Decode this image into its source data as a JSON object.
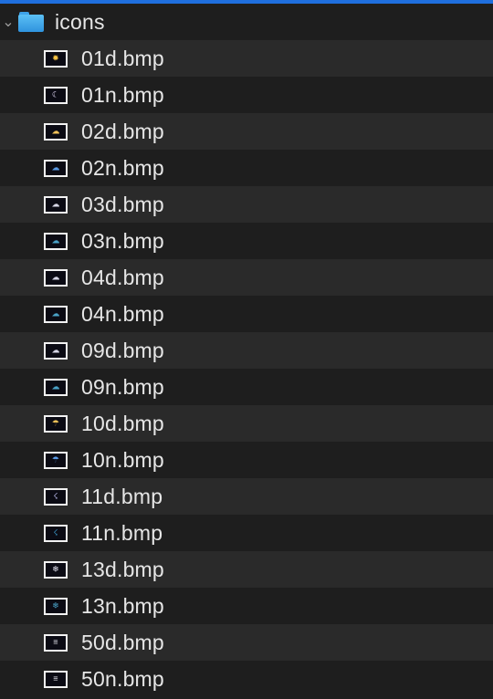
{
  "folder": {
    "name": "icons",
    "icon": "folder-icon",
    "expanded": true
  },
  "files": [
    {
      "name": "01d.bmp",
      "icon": "sun-icon",
      "color": "#f6c343"
    },
    {
      "name": "01n.bmp",
      "icon": "moon-icon",
      "color": "#e9e0ff"
    },
    {
      "name": "02d.bmp",
      "icon": "sun-cloud-icon",
      "color": "#f2c35a"
    },
    {
      "name": "02n.bmp",
      "icon": "moon-cloud-icon",
      "color": "#5a9be6"
    },
    {
      "name": "03d.bmp",
      "icon": "cloud-icon",
      "color": "#d8d8e8"
    },
    {
      "name": "03n.bmp",
      "icon": "cloud-icon",
      "color": "#4aa3c9"
    },
    {
      "name": "04d.bmp",
      "icon": "clouds-icon",
      "color": "#d8d8e8"
    },
    {
      "name": "04n.bmp",
      "icon": "clouds-icon",
      "color": "#4aa3c9"
    },
    {
      "name": "09d.bmp",
      "icon": "rain-cloud-icon",
      "color": "#d8d8e8"
    },
    {
      "name": "09n.bmp",
      "icon": "rain-cloud-icon",
      "color": "#4aa3c9"
    },
    {
      "name": "10d.bmp",
      "icon": "sun-rain-icon",
      "color": "#f2c35a"
    },
    {
      "name": "10n.bmp",
      "icon": "moon-rain-icon",
      "color": "#5a9be6"
    },
    {
      "name": "11d.bmp",
      "icon": "storm-icon",
      "color": "#c9c9ff"
    },
    {
      "name": "11n.bmp",
      "icon": "storm-icon",
      "color": "#3fa3d8"
    },
    {
      "name": "13d.bmp",
      "icon": "snow-icon",
      "color": "#e4e4f0"
    },
    {
      "name": "13n.bmp",
      "icon": "snow-icon",
      "color": "#4aa3c9"
    },
    {
      "name": "50d.bmp",
      "icon": "mist-icon",
      "color": "#e8e8f0"
    },
    {
      "name": "50n.bmp",
      "icon": "mist-icon",
      "color": "#e8e8f0"
    }
  ]
}
